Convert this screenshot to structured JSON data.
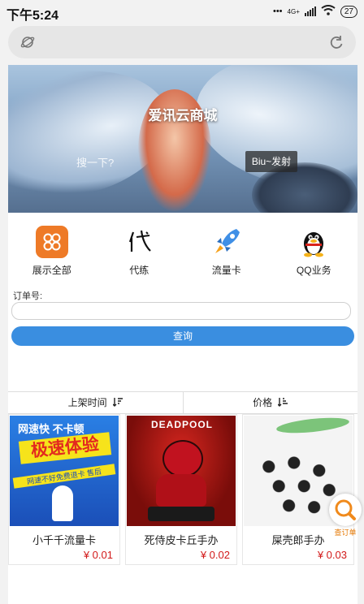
{
  "status_bar": {
    "time": "下午5:24",
    "network": "4G+",
    "battery": "27"
  },
  "banner": {
    "title": "爱讯云商城",
    "search_placeholder": "搜一下?",
    "search_button": "Biu~发射"
  },
  "nav": [
    {
      "label": "展示全部",
      "icon": "grid-icon"
    },
    {
      "label": "代练",
      "icon": "calligraphy-icon"
    },
    {
      "label": "流量卡",
      "icon": "rocket-icon"
    },
    {
      "label": "QQ业务",
      "icon": "penguin-icon"
    }
  ],
  "order": {
    "label": "订单号:",
    "value": "",
    "button": "查询"
  },
  "sort_tabs": [
    {
      "label": "上架时间",
      "icon": "sort-desc-icon"
    },
    {
      "label": "价格",
      "icon": "sort-asc-icon"
    }
  ],
  "products": [
    {
      "name": "小千千流量卡",
      "price": "¥ 0.01",
      "image_text": [
        "网速快 不卡顿",
        "极速体验",
        "网速不好免费退卡 售后"
      ]
    },
    {
      "name": "死侍皮卡丘手办",
      "price": "¥ 0.02",
      "image_text": [
        "DEADPOOL"
      ]
    },
    {
      "name": "屎壳郎手办",
      "price": "¥ 0.03",
      "image_text": []
    }
  ],
  "floating_button": {
    "label": "查订单"
  },
  "colors": {
    "accent": "#3a8ee0",
    "price": "#d21919",
    "nav_orange": "#ee7a27"
  }
}
